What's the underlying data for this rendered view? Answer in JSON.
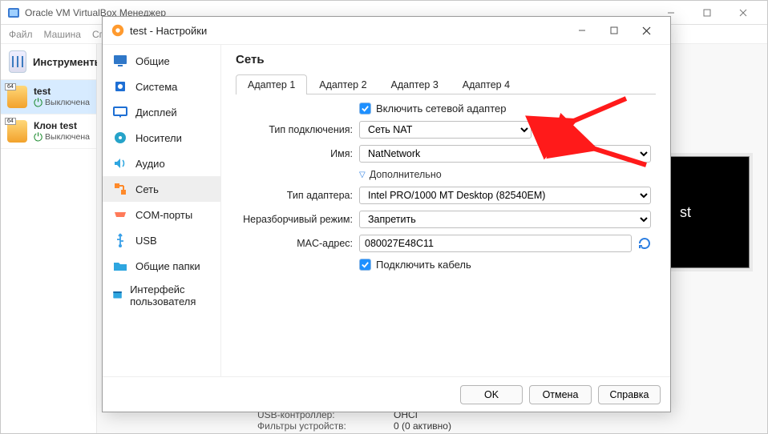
{
  "manager": {
    "title": "Oracle VM VirtualBox Менеджер",
    "menus": [
      "Файл",
      "Машина",
      "Спр"
    ],
    "tools_label": "Инструменты",
    "vms": [
      {
        "name": "test",
        "state": "Выключена",
        "badge": "64",
        "selected": true
      },
      {
        "name": "Клон test",
        "state": "Выключена",
        "badge": "64",
        "selected": false
      }
    ],
    "preview_label": "st",
    "bottom": {
      "usb_label": "USB-контроллер:",
      "usb_value": "OHCI",
      "filters_label": "Фильтры устройств:",
      "filters_value": "0 (0 активно)"
    }
  },
  "dialog": {
    "title": "test - Настройки",
    "categories": [
      {
        "id": "general",
        "label": "Общие",
        "color": "#2f77c8"
      },
      {
        "id": "system",
        "label": "Система",
        "color": "#1e6fd4"
      },
      {
        "id": "display",
        "label": "Дисплей",
        "color": "#1e6fd4"
      },
      {
        "id": "storage",
        "label": "Носители",
        "color": "#26a3c9"
      },
      {
        "id": "audio",
        "label": "Аудио",
        "color": "#2ea6e0"
      },
      {
        "id": "network",
        "label": "Сеть",
        "color": "#ff8a2a",
        "selected": true
      },
      {
        "id": "serial",
        "label": "COM-порты",
        "color": "#ff7a59"
      },
      {
        "id": "usb",
        "label": "USB",
        "color": "#3aa0e8"
      },
      {
        "id": "shared",
        "label": "Общие папки",
        "color": "#2ea6e0"
      },
      {
        "id": "ui",
        "label": "Интерфейс пользователя",
        "color": "#2ea6e0"
      }
    ],
    "section_title": "Сеть",
    "tabs": [
      "Адаптер 1",
      "Адаптер 2",
      "Адаптер 3",
      "Адаптер 4"
    ],
    "active_tab": 0,
    "enable_label": "Включить сетевой адаптер",
    "attach_label": "Тип подключения:",
    "attach_value": "Сеть NAT",
    "name_label": "Имя:",
    "name_value": "NatNetwork",
    "advanced_label": "Дополнительно",
    "adapter_type_label": "Тип адаптера:",
    "adapter_type_value": "Intel PRO/1000 MT Desktop (82540EM)",
    "promisc_label": "Неразборчивый режим:",
    "promisc_value": "Запретить",
    "mac_label": "MAC-адрес:",
    "mac_value": "080027E48C11",
    "cable_label": "Подключить кабель",
    "buttons": {
      "ok": "OK",
      "cancel": "Отмена",
      "help": "Справка"
    }
  }
}
